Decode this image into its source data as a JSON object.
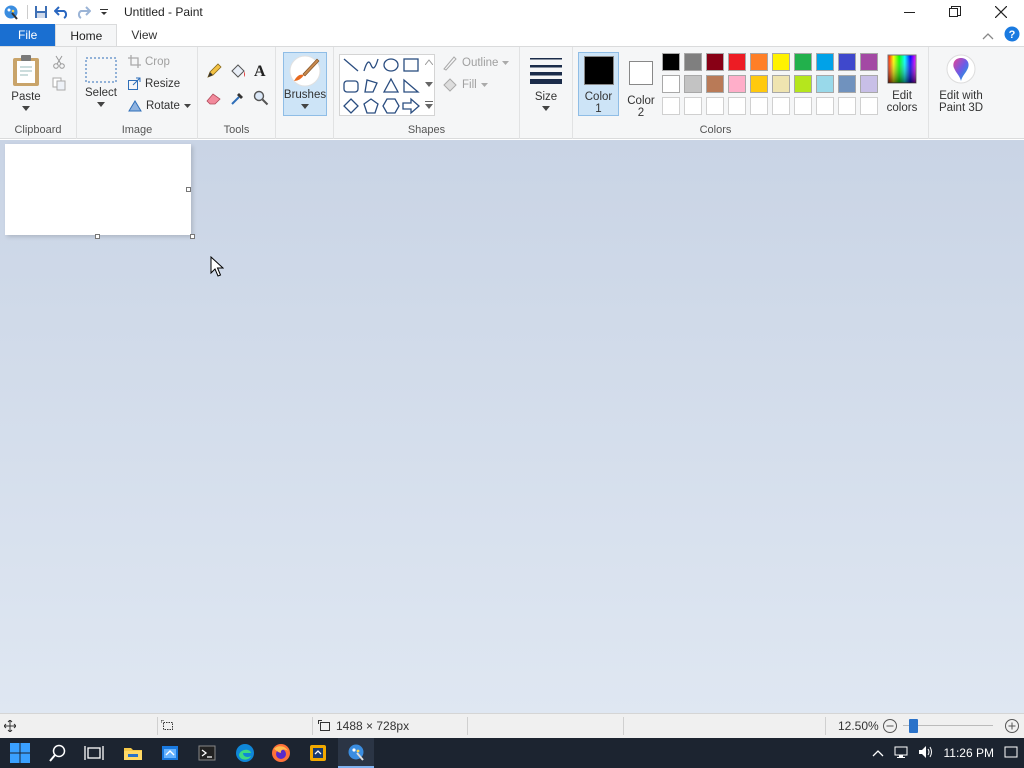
{
  "window": {
    "title": "Untitled - Paint"
  },
  "tabs": [
    {
      "label": "File"
    },
    {
      "label": "Home"
    },
    {
      "label": "View"
    }
  ],
  "ribbon": {
    "clipboard": {
      "group_label": "Clipboard",
      "paste_label": "Paste"
    },
    "image": {
      "group_label": "Image",
      "select_label": "Select",
      "crop_label": "Crop",
      "resize_label": "Resize",
      "rotate_label": "Rotate"
    },
    "tools": {
      "group_label": "Tools"
    },
    "brushes": {
      "label": "Brushes"
    },
    "shapes": {
      "group_label": "Shapes",
      "outline_label": "Outline",
      "fill_label": "Fill"
    },
    "size": {
      "label": "Size"
    },
    "colors": {
      "group_label": "Colors",
      "color1_line1": "Color",
      "color1_line2": "1",
      "color2_line1": "Color",
      "color2_line2": "2",
      "color1_value": "#000000",
      "color2_value": "#ffffff",
      "palette_row1": [
        "#000000",
        "#7f7f7f",
        "#880015",
        "#ed1c24",
        "#ff7f27",
        "#fff200",
        "#22b14c",
        "#00a2e8",
        "#3f48cc",
        "#a349a4"
      ],
      "palette_row2": [
        "#ffffff",
        "#c3c3c3",
        "#b97a57",
        "#ffaec9",
        "#ffc90e",
        "#efe4b0",
        "#b5e61d",
        "#99d9ea",
        "#7092be",
        "#c8bfe7"
      ],
      "edit_colors_line1": "Edit",
      "edit_colors_line2": "colors",
      "paint3d_line1": "Edit with",
      "paint3d_line2": "Paint 3D"
    }
  },
  "status": {
    "image_size": "1488 × 728px",
    "zoom": "12.50%",
    "zoom_level_fraction": 0.125
  },
  "taskbar": {
    "time": "11:26 PM"
  },
  "accent": "#1a6fd1"
}
